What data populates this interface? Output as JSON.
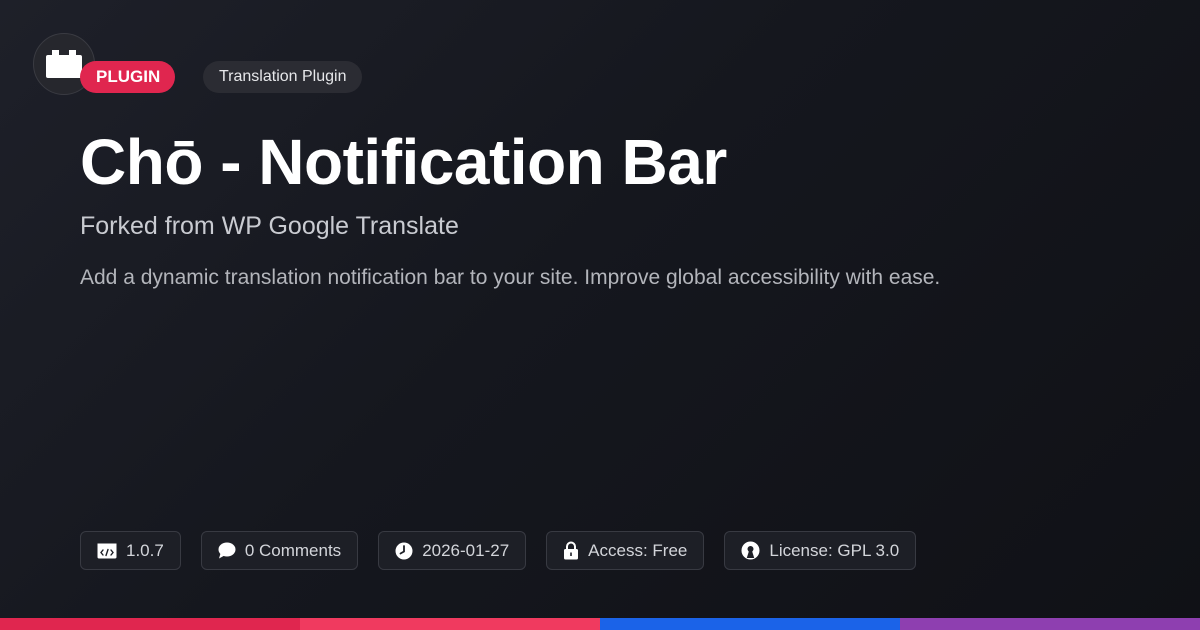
{
  "header": {
    "logo_icon": "package-icon",
    "badge_primary": "PLUGIN",
    "badge_secondary": "Translation Plugin"
  },
  "title": "Chō - Notification Bar",
  "subtitle": "Forked from WP Google Translate",
  "description": "Add a dynamic translation notification bar to your site. Improve global accessibility with ease.",
  "meta": [
    {
      "icon": "code-icon",
      "text": "1.0.7"
    },
    {
      "icon": "comment-icon",
      "text": "0 Comments"
    },
    {
      "icon": "clock-icon",
      "text": "2026-01-27"
    },
    {
      "icon": "lock-icon",
      "text": "Access: Free"
    },
    {
      "icon": "open-source-icon",
      "text": "License: GPL 3.0"
    }
  ],
  "colors": {
    "accent": "#e0264f",
    "bottom_bar": [
      "#e0264f",
      "#f03a5f",
      "#1b63e8",
      "#8e3fb0"
    ]
  }
}
